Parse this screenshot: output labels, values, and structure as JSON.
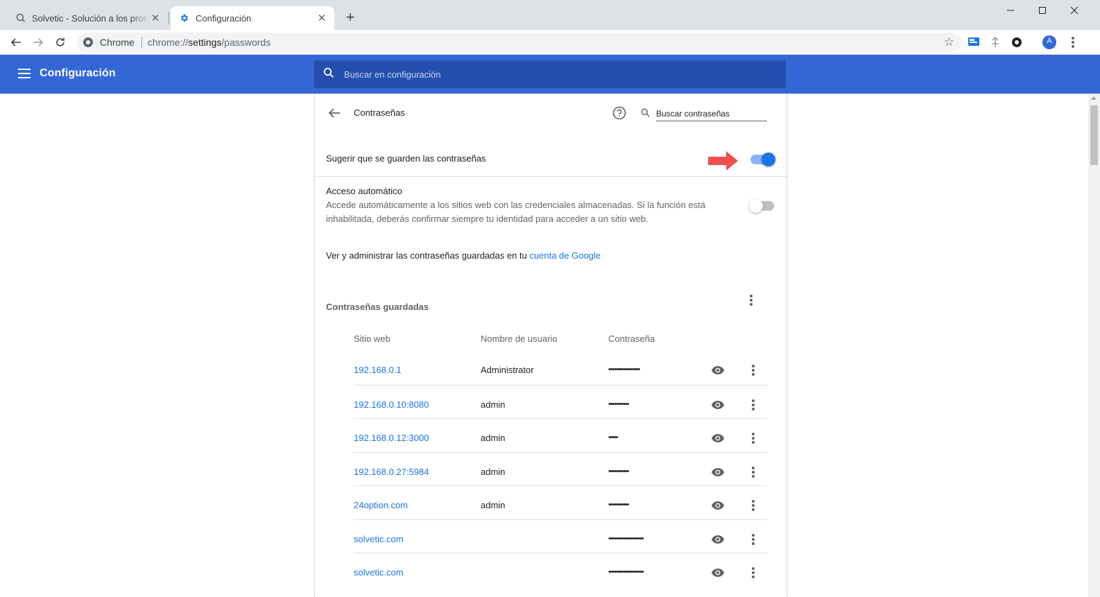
{
  "browser": {
    "tabs": [
      {
        "title": "Solvetic - Solución a los problem",
        "active": false,
        "icon": "solvetic-search-icon"
      },
      {
        "title": "Configuración",
        "active": true,
        "icon": "gear-icon"
      }
    ],
    "new_tab_label": "+",
    "omnibox": {
      "scheme_label": "Chrome",
      "url_prefix": "chrome://",
      "url_host": "settings",
      "url_path": "/passwords"
    },
    "profile_initial": "A"
  },
  "header": {
    "title": "Configuración",
    "search_placeholder": "Buscar en configuración"
  },
  "passwords_page": {
    "title": "Contraseñas",
    "search_placeholder": "Buscar contraseñas",
    "offer_to_save": {
      "label": "Sugerir que se guarden las contraseñas",
      "enabled": true
    },
    "auto_signin": {
      "label": "Acceso automático",
      "description_line1": "Accede automáticamente a los sitios web con las credenciales almacenadas. Si la función está",
      "description_line2": "inhabilitada, deberás confirmar siempre tu identidad para acceder a un sitio web.",
      "enabled": false
    },
    "manage": {
      "text": "Ver y administrar las contraseñas guardadas en tu ",
      "link": "cuenta de Google"
    },
    "saved_title": "Contraseñas guardadas",
    "columns": {
      "site": "Sitio web",
      "user": "Nombre de usuario",
      "password": "Contraseña"
    },
    "rows": [
      {
        "site": "192.168.0.1",
        "user": "Administrator",
        "password": "•••••••••••••••••"
      },
      {
        "site": "192.168.0.10:8080",
        "user": "admin",
        "password": "•••••••••••"
      },
      {
        "site": "192.168.0.12:3000",
        "user": "admin",
        "password": "•••••"
      },
      {
        "site": "192.168.0.27:5984",
        "user": "admin",
        "password": "•••••••••••"
      },
      {
        "site": "24option.com",
        "user": "admin",
        "password": "•••••••••••"
      },
      {
        "site": "solvetic.com",
        "user": "",
        "password": "•••••••••••••••••••"
      },
      {
        "site": "solvetic.com",
        "user": "",
        "password": "•••••••••••••••••••"
      }
    ]
  },
  "colors": {
    "header_blue": "#3367d6",
    "search_blue": "#254fad",
    "link_blue": "#1a73e8",
    "arrow_red": "#f0504b"
  }
}
